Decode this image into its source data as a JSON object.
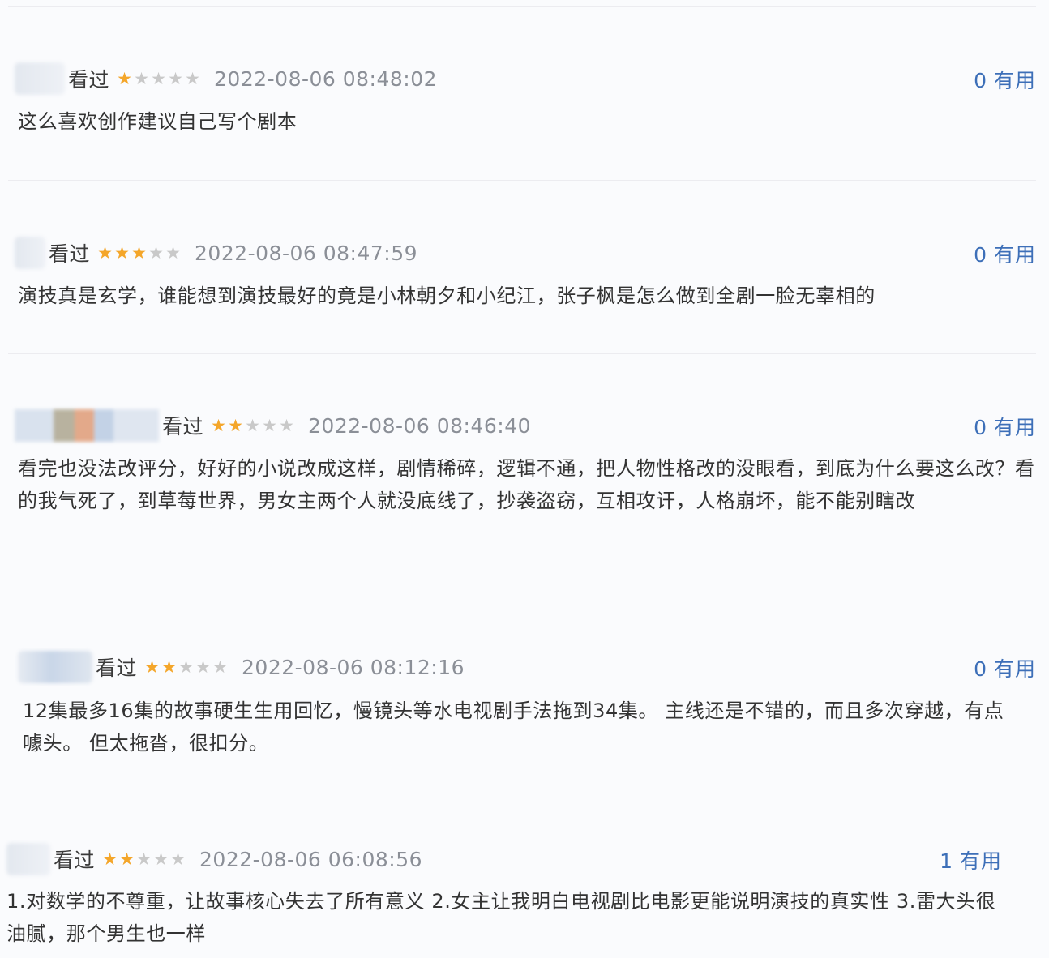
{
  "labels": {
    "watched": "看过",
    "useful": "有用"
  },
  "colors": {
    "star_on": "#f4a62a",
    "star_off": "#c9c9c9",
    "useful_link": "#3d6fb8",
    "timestamp": "#8b8f97"
  },
  "reviews": [
    {
      "rating": 1,
      "time": "2022-08-06 08:48:02",
      "useful_count": "0",
      "content": "这么喜欢创作建议自己写个剧本"
    },
    {
      "rating": 3,
      "time": "2022-08-06 08:47:59",
      "useful_count": "0",
      "content": "演技真是玄学，谁能想到演技最好的竟是小林朝夕和小纪江，张子枫是怎么做到全剧一脸无辜相的"
    },
    {
      "rating": 2,
      "time": "2022-08-06 08:46:40",
      "useful_count": "0",
      "content": "看完也没法改评分，好好的小说改成这样，剧情稀碎，逻辑不通，把人物性格改的没眼看，到底为什么要这么改？看的我气死了，到草莓世界，男女主两个人就没底线了，抄袭盗窃，互相攻讦，人格崩坏，能不能别瞎改"
    },
    {
      "rating": 2,
      "time": "2022-08-06 08:12:16",
      "useful_count": "0",
      "content": "12集最多16集的故事硬生生用回忆，慢镜头等水电视剧手法拖到34集。 主线还是不错的，而且多次穿越，有点噱头。 但太拖沓，很扣分。"
    },
    {
      "rating": 2,
      "time": "2022-08-06 06:08:56",
      "useful_count": "1",
      "content": "1.对数学的不尊重，让故事核心失去了所有意义 2.女主让我明白电视剧比电影更能说明演技的真实性 3.雷大头很油腻，那个男生也一样"
    }
  ]
}
